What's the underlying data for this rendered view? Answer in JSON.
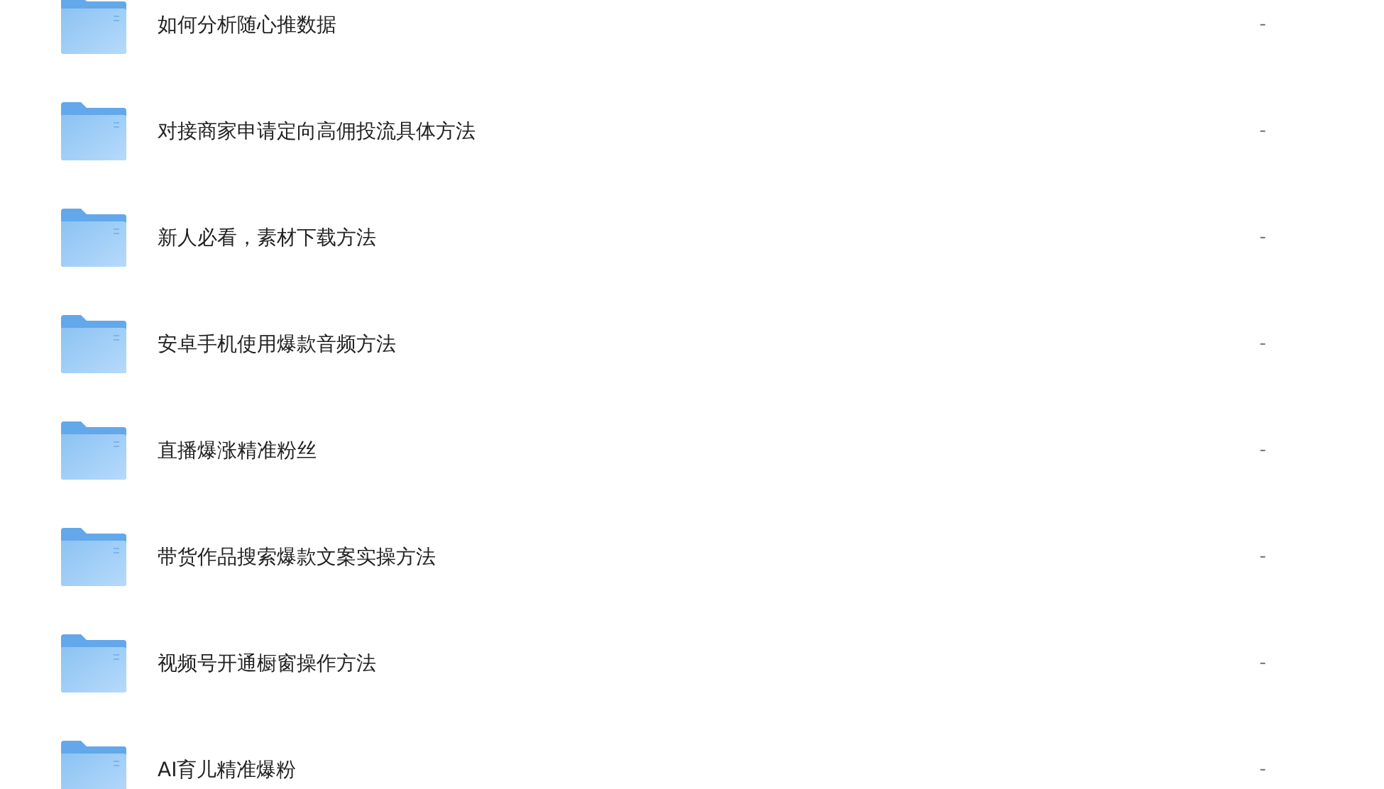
{
  "files": [
    {
      "name": "如何分析随心推数据",
      "size": "-"
    },
    {
      "name": "对接商家申请定向高佣投流具体方法",
      "size": "-"
    },
    {
      "name": "新人必看，素材下载方法",
      "size": "-"
    },
    {
      "name": "安卓手机使用爆款音频方法",
      "size": "-"
    },
    {
      "name": "直播爆涨精准粉丝",
      "size": "-"
    },
    {
      "name": "带货作品搜索爆款文案实操方法",
      "size": "-"
    },
    {
      "name": "视频号开通橱窗操作方法",
      "size": "-"
    },
    {
      "name": "AI育儿精准爆粉",
      "size": "-"
    }
  ]
}
